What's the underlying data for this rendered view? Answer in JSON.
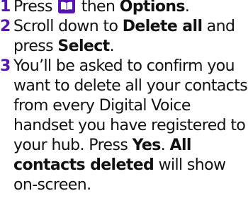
{
  "steps": [
    {
      "number": "1",
      "text_before_icon": "Press ",
      "icon": "contacts-book-icon",
      "text_after_icon": " then ",
      "bold_option": "Options",
      "end": "."
    },
    {
      "number": "2",
      "text_a": "Scroll down to ",
      "bold_a": "Delete all",
      "text_b": " and press ",
      "bold_b": "Select",
      "end": "."
    },
    {
      "number": "3",
      "text_a": "You’ll be asked to confirm you want to delete all your contacts from every Digital Voice handset you have registered to your hub. Press ",
      "bold_a": "Yes",
      "sep": ". ",
      "bold_b": "All contacts deleted",
      "text_b": " will show on-screen."
    }
  ],
  "colors": {
    "accent": "#5514b4",
    "text": "#111111"
  }
}
